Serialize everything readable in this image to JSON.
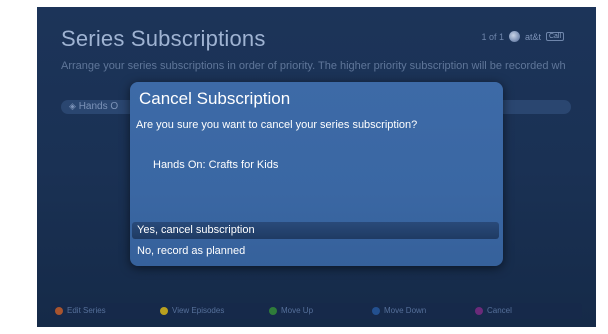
{
  "screen": {
    "title": "Series Subscriptions",
    "page_indicator": "1 of 1",
    "brand": "at&t",
    "status_icon_text": "Call",
    "description": "Arrange your series subscriptions in order of priority. The higher priority subscription will be recorded wh",
    "list_item": "Hands O"
  },
  "dialog": {
    "title": "Cancel Subscription",
    "question": "Are you sure you want to cancel your series subscription?",
    "program": "Hands On: Crafts for Kids",
    "options": [
      "Yes, cancel subscription",
      "No, record as planned"
    ],
    "selected_index": 0
  },
  "footer": {
    "items": [
      {
        "label": "Edit Series",
        "color": "#a8542e"
      },
      {
        "label": "View Episodes",
        "color": "#b9a01f"
      },
      {
        "label": "Move Up",
        "color": "#2f7c3a"
      },
      {
        "label": "Move Down",
        "color": "#23508f"
      },
      {
        "label": "Cancel",
        "color": "#6b2a7a"
      }
    ]
  },
  "colors": {
    "background": "#1c3459",
    "dialog": "#3d6aa7",
    "selected_option": "#1f3b63",
    "text": "#ffffff"
  }
}
